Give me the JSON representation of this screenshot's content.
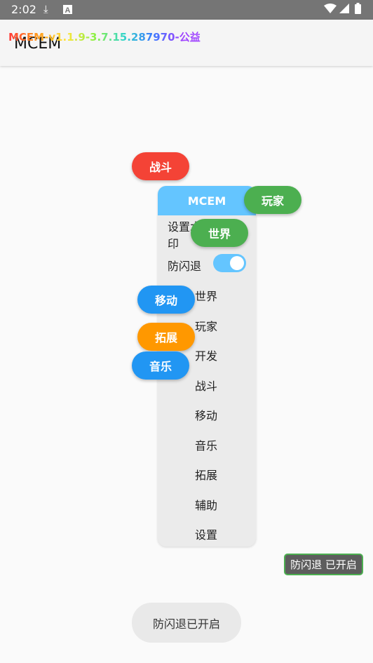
{
  "status_bar": {
    "time": "2:02",
    "icons": [
      "download-icon",
      "a-icon",
      "wifi-icon",
      "signal-icon",
      "battery-icon"
    ]
  },
  "app_bar": {
    "title": "MCEM",
    "overlay_version": "MCEM-v1.1.9-3.7.15.287970-公益"
  },
  "floating_buttons": [
    {
      "key": "combat",
      "label": "战斗",
      "color": "#f44336"
    },
    {
      "key": "player",
      "label": "玩家",
      "color": "#4caf50"
    },
    {
      "key": "world",
      "label": "世界",
      "color": "#4caf50"
    },
    {
      "key": "move",
      "label": "移动",
      "color": "#2196f3"
    },
    {
      "key": "extend",
      "label": "拓展",
      "color": "#ff9800"
    },
    {
      "key": "music",
      "label": "音乐",
      "color": "#2196f3"
    }
  ],
  "menu": {
    "header": "MCEM",
    "watermark_line1": "设置水",
    "watermark_line2": "印",
    "anti_flash_label": "防闪退",
    "anti_flash_on": true,
    "items": [
      "世界",
      "玩家",
      "开发",
      "战斗",
      "移动",
      "音乐",
      "拓展",
      "辅助",
      "设置"
    ]
  },
  "toasts": {
    "small": "防闪退 已开启",
    "big": "防闪退已开启"
  },
  "colors": {
    "accent": "#64c5ff",
    "menu_bg": "#ebebeb"
  }
}
